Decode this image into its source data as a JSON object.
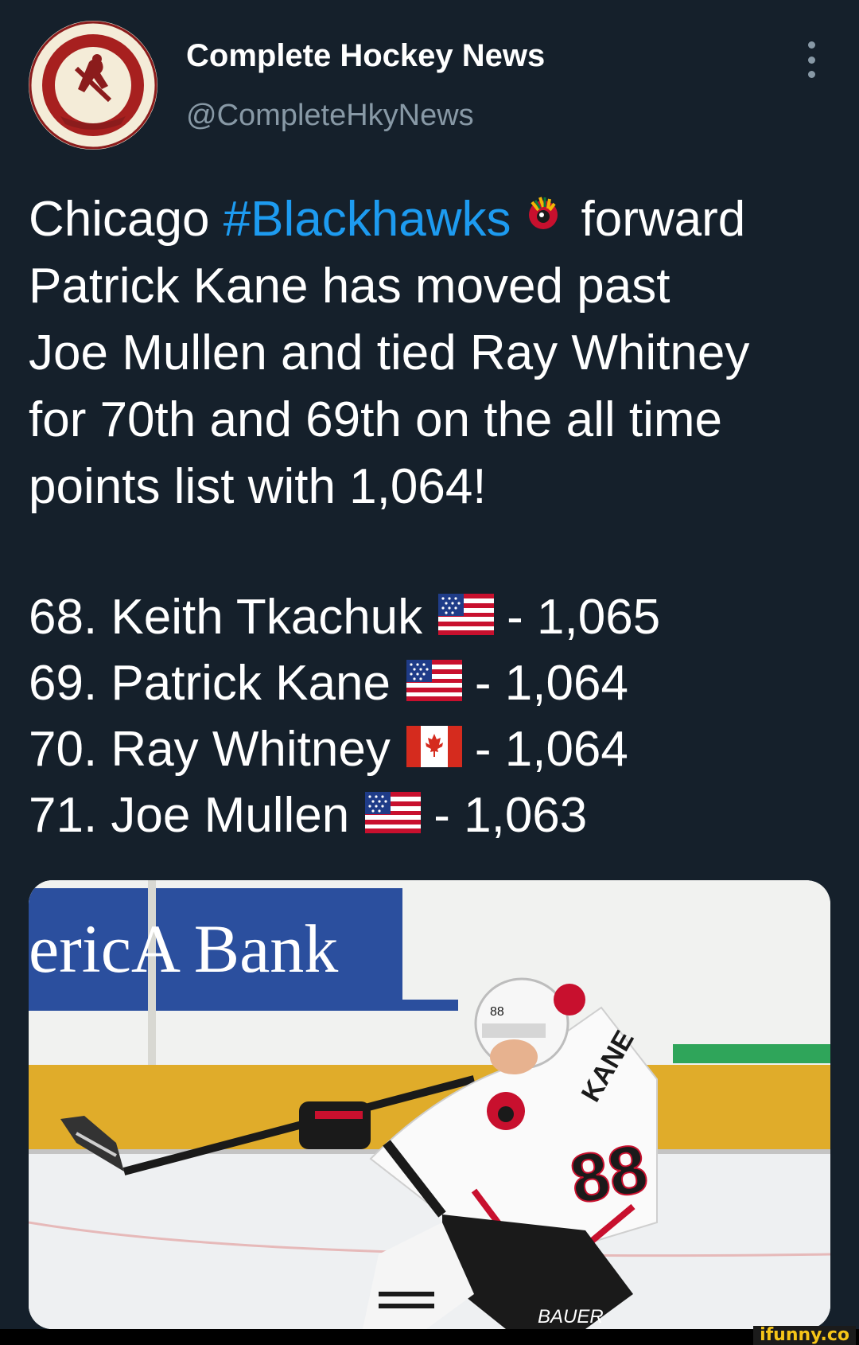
{
  "author": {
    "display_name": "Complete Hockey News",
    "handle": "@CompleteHkyNews",
    "avatar_text": "Complete Hockey News"
  },
  "tweet": {
    "line1_prefix": "Chicago ",
    "hashtag": "#Blackhawks",
    "line1_suffix": "forward",
    "line2": "Patrick Kane has moved past",
    "line3": "Joe Mullen and tied Ray Whitney",
    "line4": "for 70th and 69th on the all time",
    "line5": "points list with 1,064!"
  },
  "rankings": [
    {
      "rank": "68. Keith Tkachuk",
      "flag": "us-flag",
      "points": "- 1,065"
    },
    {
      "rank": "69. Patrick Kane",
      "flag": "us-flag",
      "points": "- 1,064"
    },
    {
      "rank": "70. Ray Whitney",
      "flag": "canada-flag",
      "points": "- 1,064"
    },
    {
      "rank": "71. Joe Mullen",
      "flag": "us-flag",
      "points": "- 1,063"
    }
  ],
  "media": {
    "banner_text": "ericA Bank",
    "helmet_number": "88",
    "jersey_name": "KANE",
    "jersey_number": "88",
    "stick_brand": "BAUER"
  },
  "watermark": "ifunny.co",
  "colors": {
    "background": "#15202b",
    "text": "#ffffff",
    "secondary_text": "#8899a6",
    "link": "#1d9bf0"
  },
  "icons": {
    "more": "more-vertical-icon",
    "team_emoji": "blackhawks-logo-icon"
  }
}
